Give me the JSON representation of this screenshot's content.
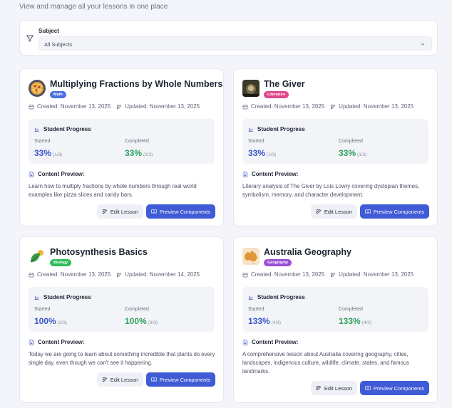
{
  "header": {
    "subtitle": "View and manage all your lessons in one place"
  },
  "filter": {
    "label": "Subject",
    "selected": "All Subjects"
  },
  "progress_title": "Student Progress",
  "started_label": "Started",
  "completed_label": "Completed",
  "preview_title": "Content Preview:",
  "edit_label": "Edit Lesson",
  "preview_button_label": "Preview Components",
  "lessons": [
    {
      "title": "Multiplying Fractions by Whole Numbers",
      "subject": "Math",
      "subject_color": "#4a6fe0",
      "created": "Created: November 13, 2025",
      "updated": "Updated: November 13, 2025",
      "started_pct": "33%",
      "started_frac": "(1/3)",
      "completed_pct": "33%",
      "completed_frac": "(1/3)",
      "preview": "Learn how to multiply fractions by whole numbers through real-world examples like pizza slices and candy bars.",
      "icon": "pizza-icon"
    },
    {
      "title": "The Giver",
      "subject": "Literature",
      "subject_color": "#e0468c",
      "created": "Created: November 13, 2025",
      "updated": "Updated: November 13, 2025",
      "started_pct": "33%",
      "started_frac": "(1/3)",
      "completed_pct": "33%",
      "completed_frac": "(1/3)",
      "preview": "Literary analysis of The Giver by Lois Lowry covering dystopian themes, symbolism, memory, and character development.",
      "icon": "book-cover-icon"
    },
    {
      "title": "Photosynthesis Basics",
      "subject": "Biology",
      "subject_color": "#2ebd5a",
      "created": "Created: November 13, 2025",
      "updated": "Updated: November 14, 2025",
      "started_pct": "100%",
      "started_frac": "(3/3)",
      "completed_pct": "100%",
      "completed_frac": "(3/3)",
      "preview": "Today we are going to learn about something incredible that plants do every single day, even though we can't see it happening.",
      "icon": "leaf-sun-icon"
    },
    {
      "title": "Australia Geography",
      "subject": "Geography",
      "subject_color": "#9a4fd6",
      "created": "Created: November 13, 2025",
      "updated": "Updated: November 13, 2025",
      "started_pct": "133%",
      "started_frac": "(4/3)",
      "completed_pct": "133%",
      "completed_frac": "(4/3)",
      "preview": "A comprehensive lesson about Australia covering geography, cities, landscapes, indigenous culture, wildlife, climate, states, and famous landmarks.",
      "icon": "australia-map-icon"
    }
  ]
}
